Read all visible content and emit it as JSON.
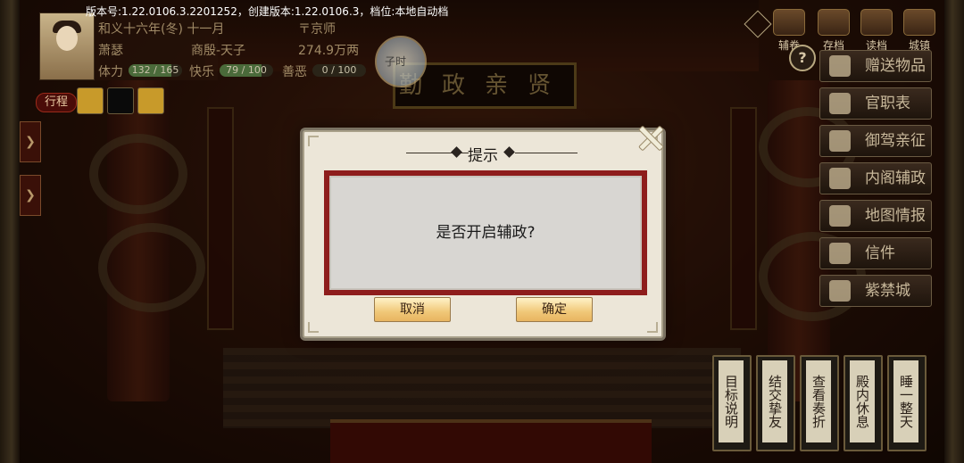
{
  "version_line": "版本号:1.22.0106.3.2201252，创建版本:1.22.0106.3，档位:本地自动档",
  "player": {
    "date": "和义十六年(冬) 十一月",
    "location": "京师",
    "name": "萧瑟",
    "title": "商殷-天子",
    "wealth": "274.9万两",
    "stats": [
      {
        "label": "体力",
        "value": "132 / 165",
        "fraction": 0.8
      },
      {
        "label": "快乐",
        "value": "79 / 100",
        "fraction": 0.79
      },
      {
        "label": "善恶",
        "value": "0 / 100",
        "fraction": 0.0
      }
    ],
    "itinerary_label": "行程"
  },
  "clock_label": "子时",
  "plaque_text": "勤政亲贤",
  "top_icons": [
    {
      "label": "辅卷",
      "icon": "scroll-icon"
    },
    {
      "label": "存档",
      "icon": "save-icon"
    },
    {
      "label": "读档",
      "icon": "load-icon"
    },
    {
      "label": "城镇",
      "icon": "castle-icon"
    }
  ],
  "side_menu": [
    {
      "label": "赠送物品",
      "icon": "gift-icon"
    },
    {
      "label": "官职表",
      "icon": "officials-icon"
    },
    {
      "label": "御驾亲征",
      "icon": "campaign-icon"
    },
    {
      "label": "内阁辅政",
      "icon": "cabinet-icon"
    },
    {
      "label": "地图情报",
      "icon": "map-icon"
    },
    {
      "label": "信件",
      "icon": "letter-icon"
    },
    {
      "label": "紫禁城",
      "icon": "palace-icon"
    }
  ],
  "bottom_actions": [
    {
      "label": "目标说明"
    },
    {
      "label": "结交挚友"
    },
    {
      "label": "查看奏折"
    },
    {
      "label": "殿内休息"
    },
    {
      "label": "睡一整天"
    }
  ],
  "dialog": {
    "title": "提示",
    "message": "是否开启辅政?",
    "cancel_label": "取消",
    "confirm_label": "确定"
  }
}
